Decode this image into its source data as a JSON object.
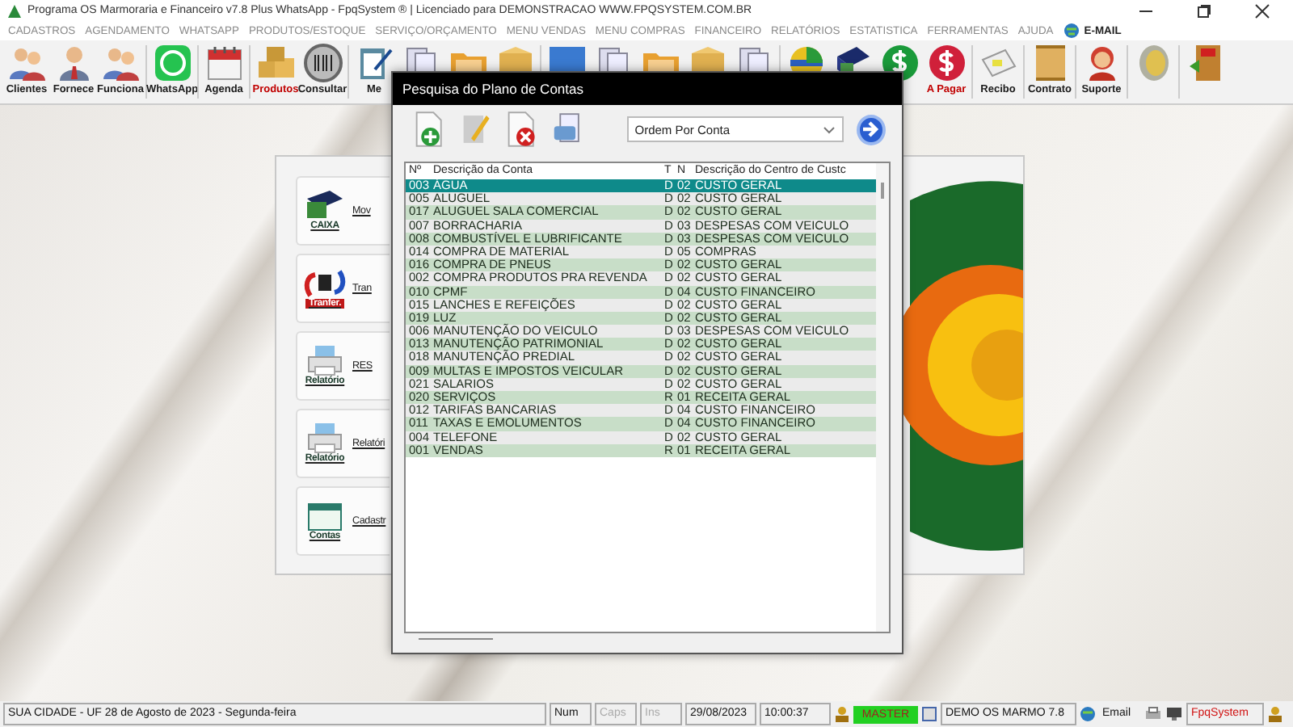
{
  "window": {
    "title": "Programa OS Marmoraria e Financeiro v7.8 Plus WhatsApp - FpqSystem ® | Licenciado para  DEMONSTRACAO WWW.FPQSYSTEM.COM.BR"
  },
  "menu": [
    {
      "label": "CADASTROS"
    },
    {
      "label": "AGENDAMENTO"
    },
    {
      "label": "WHATSAPP"
    },
    {
      "label": "PRODUTOS/ESTOQUE"
    },
    {
      "label": "SERVIÇO/ORÇAMENTO"
    },
    {
      "label": "MENU VENDAS"
    },
    {
      "label": "MENU COMPRAS"
    },
    {
      "label": "FINANCEIRO"
    },
    {
      "label": "RELATÓRIOS"
    },
    {
      "label": "ESTATISTICA"
    },
    {
      "label": "FERRAMENTAS"
    },
    {
      "label": "AJUDA"
    }
  ],
  "email_menu": {
    "label": "E-MAIL"
  },
  "toolbar": [
    {
      "label": "Clientes",
      "color": "#1a1a1a"
    },
    {
      "label": "Fornece",
      "color": "#1a1a1a"
    },
    {
      "label": "Funciona",
      "color": "#1a1a1a"
    },
    {
      "label": "WhatsApp",
      "color": "#1a1a1a"
    },
    {
      "label": "Agenda",
      "color": "#1a1a1a"
    },
    {
      "label": "Produtos",
      "color": "#c00000"
    },
    {
      "label": "Consultar",
      "color": "#1a1a1a"
    },
    {
      "label": "Me",
      "color": "#1a1a1a"
    },
    {
      "label": "A Pagar",
      "color": "#c00000"
    },
    {
      "label": "Recibo",
      "color": "#1a1a1a"
    },
    {
      "label": "Contrato",
      "color": "#1a1a1a"
    },
    {
      "label": "Suporte",
      "color": "#1a1a1a"
    }
  ],
  "side_panel": [
    {
      "badge": "CAIXA",
      "label": "Mov"
    },
    {
      "badge": "Tranfer.",
      "label": "Tran"
    },
    {
      "badge": "Relatório",
      "label": "RES"
    },
    {
      "badge": "Relatório",
      "label": "Relatóri"
    },
    {
      "badge": "Contas",
      "label": "Cadastr"
    }
  ],
  "dialog": {
    "title": "Pesquisa do Plano de Contas",
    "order_select": {
      "value": "Ordem Por Conta"
    },
    "columns": [
      "Nº",
      "Descrição da Conta",
      "T",
      "N",
      "Descrição do Centro de Custc"
    ],
    "rows": [
      {
        "cells": [
          "003",
          "ÁGUA",
          "D",
          "02",
          "CUSTO GERAL"
        ],
        "selected": true
      },
      {
        "cells": [
          "005",
          "ALUGUEL",
          "D",
          "02",
          "CUSTO GERAL"
        ],
        "selected": false
      },
      {
        "cells": [
          "017",
          "ALUGUEL SALA COMERCIAL",
          "D",
          "02",
          "CUSTO GERAL"
        ],
        "selected": false
      },
      {
        "cells": [
          "007",
          "BORRACHARIA",
          "D",
          "03",
          "DESPESAS COM VEICULO"
        ],
        "selected": false
      },
      {
        "cells": [
          "008",
          "COMBUSTÍVEL E LUBRIFICANTE",
          "D",
          "03",
          "DESPESAS COM VEICULO"
        ],
        "selected": false
      },
      {
        "cells": [
          "014",
          "COMPRA DE MATERIAL",
          "D",
          "05",
          "COMPRAS"
        ],
        "selected": false
      },
      {
        "cells": [
          "016",
          "COMPRA DE PNEUS",
          "D",
          "02",
          "CUSTO GERAL"
        ],
        "selected": false
      },
      {
        "cells": [
          "002",
          "COMPRA PRODUTOS PRA REVENDA",
          "D",
          "02",
          "CUSTO GERAL"
        ],
        "selected": false
      },
      {
        "cells": [
          "010",
          "CPMF",
          "D",
          "04",
          "CUSTO FINANCEIRO"
        ],
        "selected": false
      },
      {
        "cells": [
          "015",
          "LANCHES E REFEIÇÕES",
          "D",
          "02",
          "CUSTO GERAL"
        ],
        "selected": false
      },
      {
        "cells": [
          "019",
          "LUZ",
          "D",
          "02",
          "CUSTO GERAL"
        ],
        "selected": false
      },
      {
        "cells": [
          "006",
          "MANUTENÇÃO DO VEICULO",
          "D",
          "03",
          "DESPESAS COM VEICULO"
        ],
        "selected": false
      },
      {
        "cells": [
          "013",
          "MANUTENÇÃO PATRIMONIAL",
          "D",
          "02",
          "CUSTO GERAL"
        ],
        "selected": false
      },
      {
        "cells": [
          "018",
          "MANUTENÇÃO PREDIAL",
          "D",
          "02",
          "CUSTO GERAL"
        ],
        "selected": false
      },
      {
        "cells": [
          "009",
          "MULTAS E IMPOSTOS VEICULAR",
          "D",
          "02",
          "CUSTO GERAL"
        ],
        "selected": false
      },
      {
        "cells": [
          "021",
          "SALARIOS",
          "D",
          "02",
          "CUSTO GERAL"
        ],
        "selected": false
      },
      {
        "cells": [
          "020",
          "SERVIÇOS",
          "R",
          "01",
          "RECEITA GERAL"
        ],
        "selected": false
      },
      {
        "cells": [
          "012",
          "TARIFAS BANCARIAS",
          "D",
          "04",
          "CUSTO FINANCEIRO"
        ],
        "selected": false
      },
      {
        "cells": [
          "011",
          "TAXAS E EMOLUMENTOS",
          "D",
          "04",
          "CUSTO FINANCEIRO"
        ],
        "selected": false
      },
      {
        "cells": [
          "004",
          "TELEFONE",
          "D",
          "02",
          "CUSTO GERAL"
        ],
        "selected": false
      },
      {
        "cells": [
          "001",
          "VENDAS",
          "R",
          "01",
          "RECEITA GERAL"
        ],
        "selected": false
      }
    ]
  },
  "status_bar": {
    "location": "SUA CIDADE - UF 28 de Agosto de 2023 - Segunda-feira",
    "keys": [
      {
        "label": "Num",
        "disabled": false
      },
      {
        "label": "Caps",
        "disabled": true
      },
      {
        "label": "Ins",
        "disabled": true
      }
    ],
    "date": "29/08/2023",
    "time": "10:00:37",
    "user": "MASTER",
    "company": "DEMO OS MARMO 7.8",
    "email": "Email",
    "brand": "FpqSystem"
  }
}
